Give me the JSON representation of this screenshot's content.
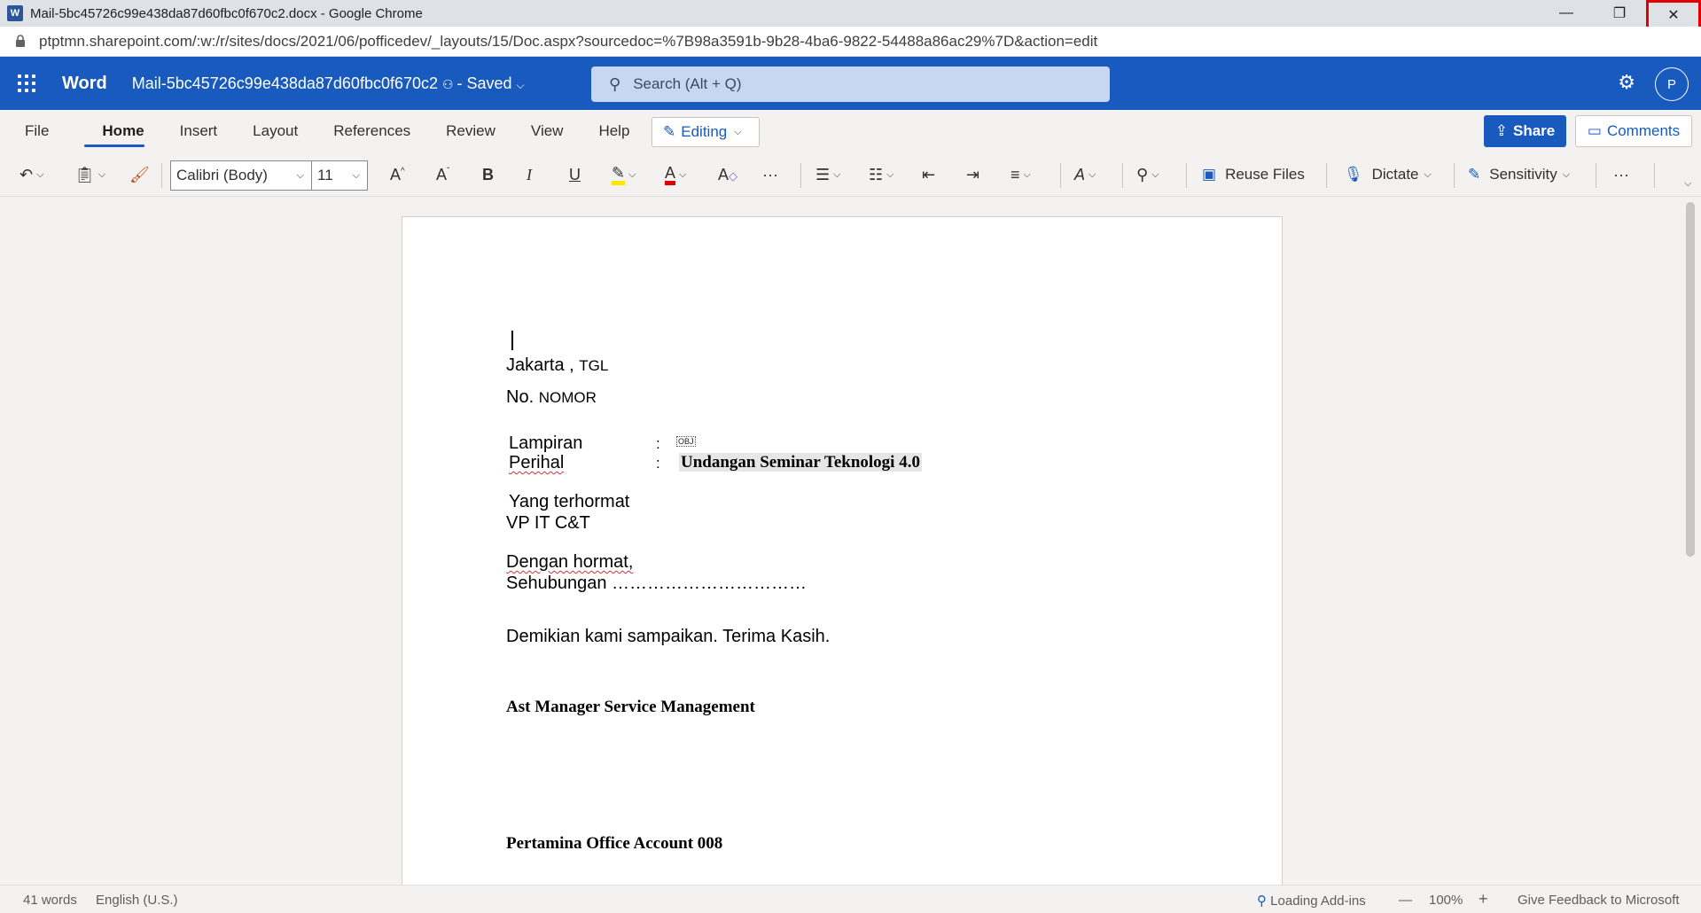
{
  "browser": {
    "title": "Mail-5bc45726c99e438da87d60fbc0f670c2.docx - Google Chrome",
    "url": "ptptmn.sharepoint.com/:w:/r/sites/docs/2021/06/pofficedev/_layouts/15/Doc.aspx?sourcedoc=%7B98a3591b-9b28-4ba6-9822-54488a86ac29%7D&action=edit",
    "minimize": "—",
    "restore": "❐",
    "close": "✕"
  },
  "word": {
    "app_name": "Word",
    "doc_name": "Mail-5bc45726c99e438da87d60fbc0f670c2",
    "saved": "Saved",
    "search_placeholder": "Search (Alt + Q)",
    "avatar_initial": "P"
  },
  "ribbon": {
    "tabs": [
      "File",
      "Home",
      "Insert",
      "Layout",
      "References",
      "Review",
      "View",
      "Help"
    ],
    "editing": "Editing",
    "share": "Share",
    "comments": "Comments",
    "font_name": "Calibri (Body)",
    "font_size": "11",
    "reuse_files": "Reuse Files",
    "dictate": "Dictate",
    "sensitivity": "Sensitivity"
  },
  "document": {
    "line_city": "Jakarta ,",
    "line_city_tag": "TGL",
    "line_no": "No.",
    "line_no_tag": "NOMOR",
    "lampiran_label": "Lampiran",
    "perihal_label": "Perihal",
    "colon": ":",
    "perihal_value": "Undangan Seminar Teknologi 4.0",
    "obj_marker": "OBJ",
    "yang_terhormat": "Yang terhormat",
    "recipient": "VP IT C&T",
    "greeting": "Dengan hormat,",
    "body": "Sehubungan ……………………………",
    "closing": "Demikian kami sampaikan. Terima Kasih.",
    "signer_title": "Ast Manager Service Management",
    "signer_name": "Pertamina Office Account 008"
  },
  "status": {
    "words": "41 words",
    "language": "English (U.S.)",
    "loading": "Loading Add-ins",
    "zoom_minus": "—",
    "zoom": "100%",
    "zoom_plus": "+",
    "feedback": "Give Feedback to Microsoft"
  }
}
